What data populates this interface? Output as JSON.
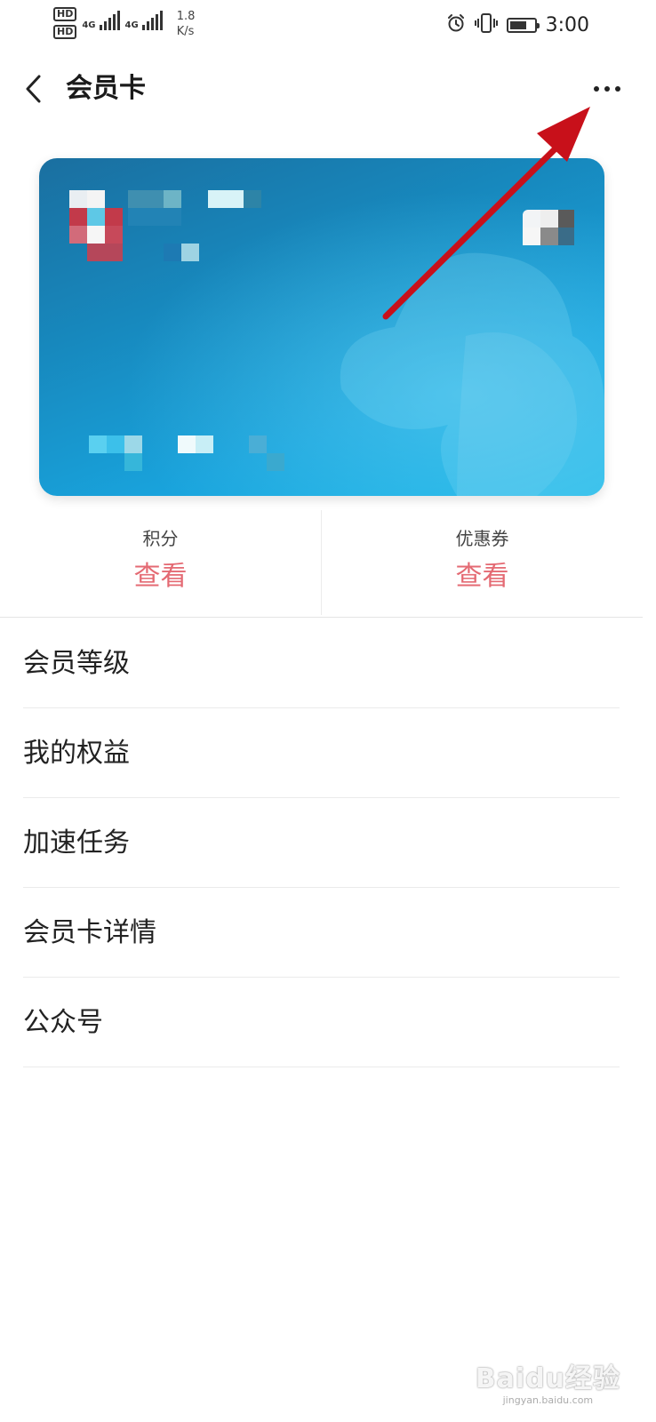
{
  "status_bar": {
    "hd1": "HD",
    "hd2": "HD",
    "sim1_network": "4G",
    "sim2_network": "4G",
    "speed_value": "1.8",
    "speed_unit": "K/s",
    "time": "3:00",
    "battery_level": 0.7,
    "icons": [
      "alarm-icon",
      "vibrate-icon",
      "battery-icon"
    ]
  },
  "header": {
    "title": "会员卡",
    "back_icon": "chevron-left-icon",
    "more_icon": "more-horizontal-icon"
  },
  "card": {
    "gradient_start": "#1a6fa0",
    "gradient_end": "#19b6e8",
    "content_obscured": true
  },
  "stats": [
    {
      "label": "积分",
      "value": "查看"
    },
    {
      "label": "优惠券",
      "value": "查看"
    }
  ],
  "accent_color": "#e46a73",
  "menu": [
    {
      "label": "会员等级"
    },
    {
      "label": "我的权益"
    },
    {
      "label": "加速任务"
    },
    {
      "label": "会员卡详情"
    },
    {
      "label": "公众号"
    }
  ],
  "annotation": {
    "type": "arrow",
    "color": "#c8101a",
    "target": "more-button"
  },
  "watermark": {
    "logo": "Baidu经验",
    "url": "jingyan.baidu.com"
  }
}
